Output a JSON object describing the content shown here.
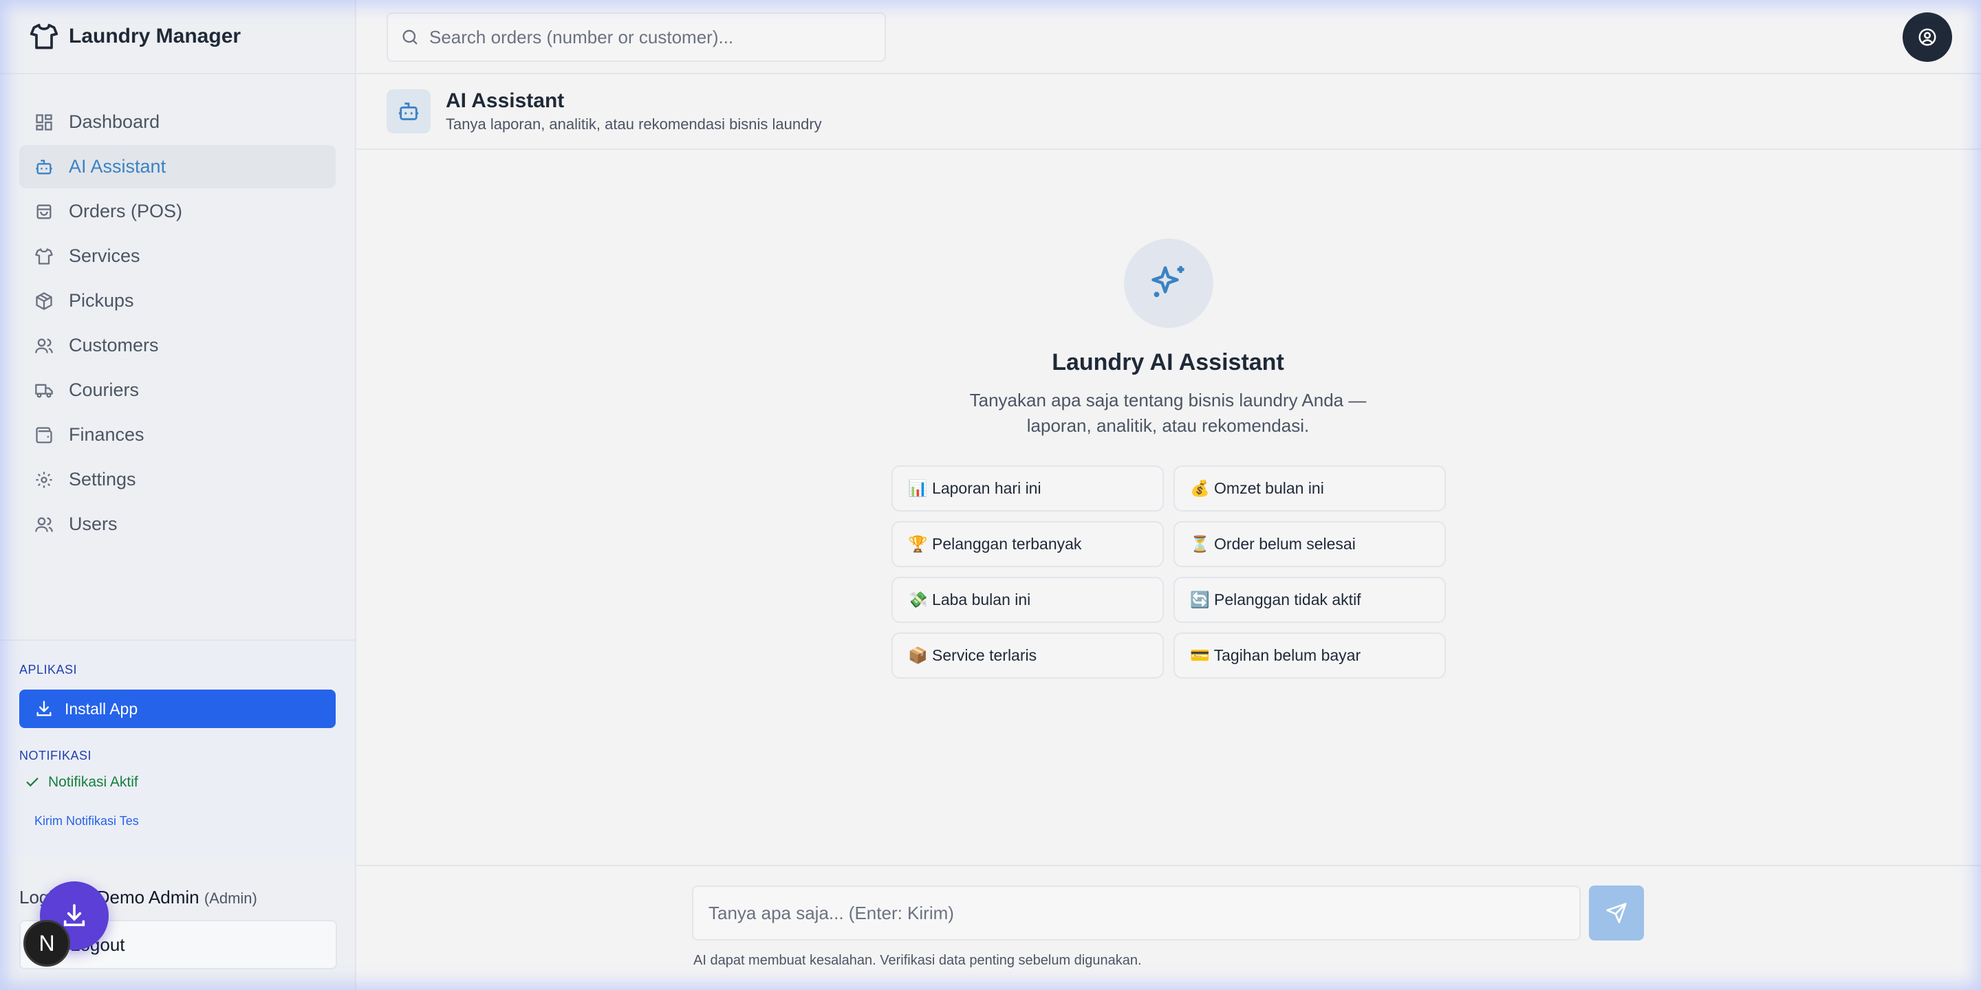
{
  "app": {
    "title": "Laundry Manager"
  },
  "sidebar": {
    "items": [
      {
        "label": "Dashboard",
        "icon": "dashboard-icon",
        "active": false
      },
      {
        "label": "AI Assistant",
        "icon": "bot-icon",
        "active": true
      },
      {
        "label": "Orders (POS)",
        "icon": "shopping-bag-icon",
        "active": false
      },
      {
        "label": "Services",
        "icon": "shirt-icon",
        "active": false
      },
      {
        "label": "Pickups",
        "icon": "package-icon",
        "active": false
      },
      {
        "label": "Customers",
        "icon": "users-icon",
        "active": false
      },
      {
        "label": "Couriers",
        "icon": "truck-icon",
        "active": false
      },
      {
        "label": "Finances",
        "icon": "wallet-icon",
        "active": false
      },
      {
        "label": "Settings",
        "icon": "gear-icon",
        "active": false
      },
      {
        "label": "Users",
        "icon": "users-icon",
        "active": false
      }
    ],
    "apps_label": "APLIKASI",
    "install_label": "Install App",
    "notif_label": "NOTIFIKASI",
    "notif_active": "Notifikasi Aktif",
    "test_notif": "Kirim Notifikasi Tes",
    "login_prefix": "Login as:",
    "login_name": "Demo Admin",
    "login_role": "(Admin)",
    "logout_label": "Logout"
  },
  "topbar": {
    "search_placeholder": "Search orders (number or customer)..."
  },
  "page": {
    "title": "AI Assistant",
    "subtitle": "Tanya laporan, analitik, atau rekomendasi bisnis laundry"
  },
  "hero": {
    "title": "Laundry AI Assistant",
    "description": "Tanyakan apa saja tentang bisnis laundry Anda — laporan, analitik, atau rekomendasi."
  },
  "suggestions": [
    "📊 Laporan hari ini",
    "💰 Omzet bulan ini",
    "🏆 Pelanggan terbanyak",
    "⏳ Order belum selesai",
    "💸 Laba bulan ini",
    "🔄 Pelanggan tidak aktif",
    "📦 Service terlaris",
    "💳 Tagihan belum bayar"
  ],
  "chat": {
    "placeholder": "Tanya apa saja... (Enter: Kirim)",
    "disclaimer": "AI dapat membuat kesalahan. Verifikasi data penting sebelum digunakan."
  },
  "floating": {
    "badge_letter": "N"
  },
  "colors": {
    "accent": "#3b82c4",
    "primary_button": "#2563eb",
    "success": "#15803d",
    "fab": "#5b3fd6"
  }
}
